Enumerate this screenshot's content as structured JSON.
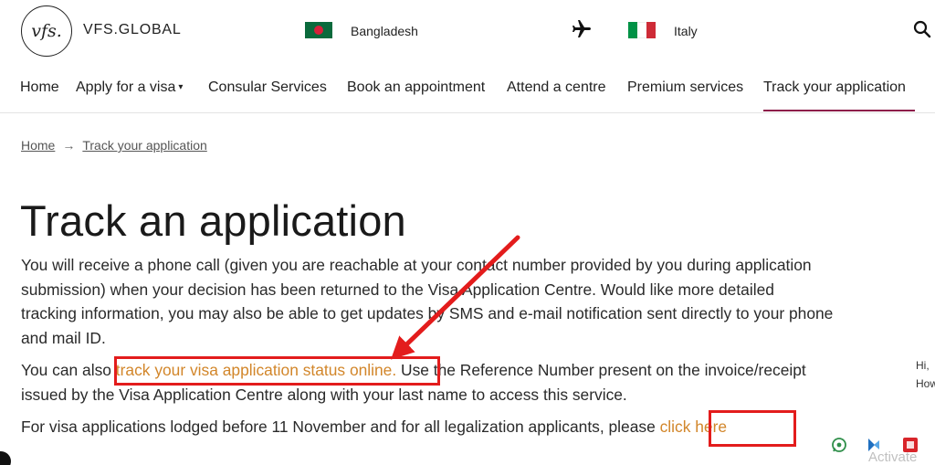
{
  "header": {
    "logo_mark": "vfs.",
    "brand": "VFS.GLOBAL",
    "from_country": "Bangladesh",
    "to_country": "Italy",
    "icons": [
      "vfs-logo",
      "bangladesh-flag-icon",
      "plane-icon",
      "italy-flag-icon",
      "search-icon"
    ],
    "colors": {
      "bd_green": "#0a6a3c",
      "bd_red": "#d6203a",
      "it_green": "#009246",
      "it_white": "#ffffff",
      "it_red": "#ce2b37"
    }
  },
  "nav": {
    "items": [
      {
        "label": "Home"
      },
      {
        "label": "Apply for a visa",
        "caret": "▾"
      },
      {
        "label": "Consular Services"
      },
      {
        "label": "Book an appointment"
      },
      {
        "label": "Attend a centre"
      },
      {
        "label": "Premium services"
      },
      {
        "label": "Track your application",
        "active": true
      }
    ],
    "active_color": "#8d1d4a"
  },
  "breadcrumb": {
    "home": "Home",
    "separator": "→",
    "current": "Track your application"
  },
  "page": {
    "title": "Track an application",
    "p1": "You will receive a phone call (given you are reachable at your contact number provided by you during application submission) when your decision has been returned to the Visa Application Centre. Would like more detailed tracking information, you may also be able to get updates by SMS and e-mail notification sent directly to your phone and mail ID.",
    "p2_before": "You can also ",
    "p2_link": "track your visa application status online.",
    "p2_after": " Use the Reference Number present on the invoice/receipt issued by the Visa Application Centre along with your last name to access this service.",
    "p3_before": "For visa applications lodged before 11 November and for all legalization applicants, please ",
    "p3_link": "click here",
    "link_color": "#d2862a"
  },
  "annotation": {
    "highlight_color": "#e31c1c"
  },
  "overlay": {
    "chat_line1": "Hi,",
    "chat_line2": "How",
    "watermark": "Activate",
    "icons": [
      "whatsapp-icon",
      "chat-bot-icon",
      "red-widget-icon"
    ]
  }
}
